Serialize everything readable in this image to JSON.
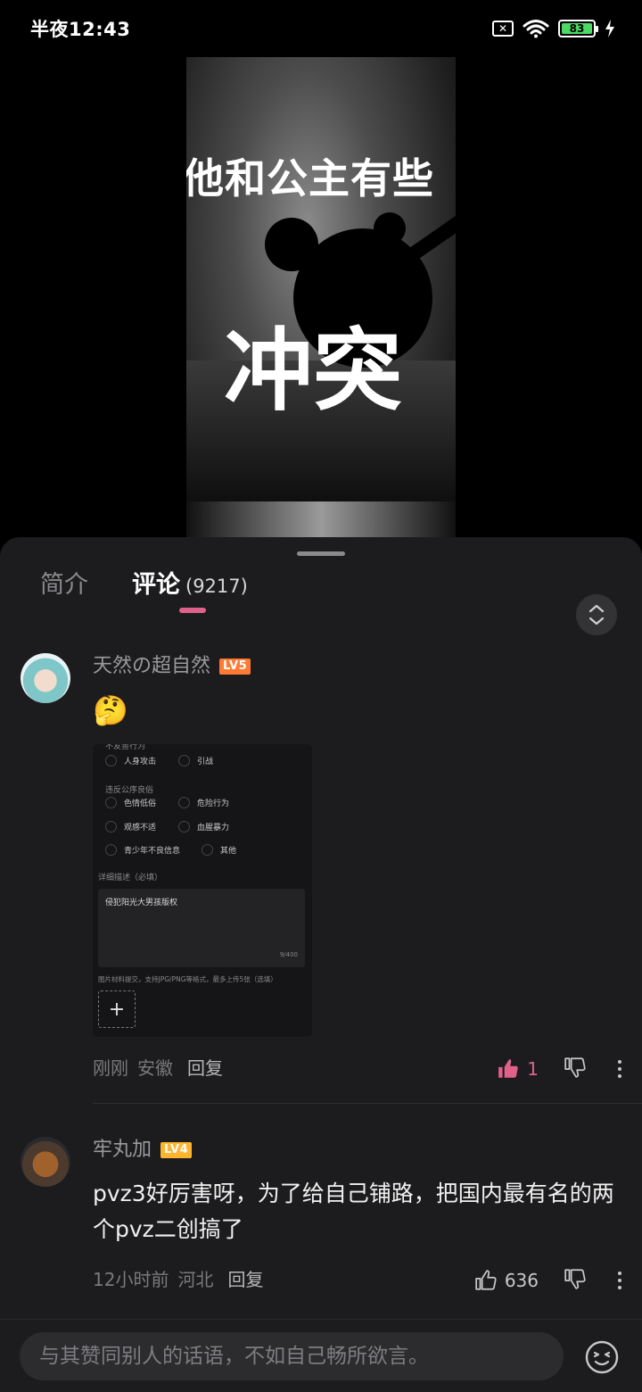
{
  "status_bar": {
    "time": "半夜12:43",
    "battery_level": "83"
  },
  "video": {
    "line1": "他和公主有些",
    "line2": "冲突"
  },
  "tabs": {
    "intro": "简介",
    "comments": "评论",
    "comments_count": "(9217)"
  },
  "comments": [
    {
      "username": "天然の超自然",
      "level": "LV5",
      "emoji": "🤔",
      "screenshot": {
        "sec1_top": "不友善行为",
        "opt_personal_attack": "人身攻击",
        "opt_flame": "引战",
        "sec2": "违反公序良俗",
        "opt_vulgar": "色情低俗",
        "opt_dangerous": "危险行为",
        "opt_uncomfortable": "观感不适",
        "opt_gore": "血腥暴力",
        "opt_minor": "青少年不良信息",
        "opt_other": "其他",
        "detail_label": "详细描述（必填）",
        "detail_text": "侵犯阳光大男孩版权",
        "detail_count": "9/400",
        "upload_note": "图片材料提交，支持JPG/PNG等格式，最多上传5张（选填）",
        "add": "+"
      },
      "time": "刚刚",
      "location": "安徽",
      "reply": "回复",
      "likes": "1"
    },
    {
      "username": "牢丸加",
      "level": "LV4",
      "text": "pvz3好厉害呀，为了给自己铺路，把国内最有名的两个pvz二创搞了",
      "time": "12小时前",
      "location": "河北",
      "reply": "回复",
      "likes": "636"
    }
  ],
  "input": {
    "placeholder": "与其赞同别人的话语，不如自己畅所欲言。"
  },
  "colors": {
    "accent": "#e0618a",
    "sheet_bg": "#1c1c1e"
  }
}
